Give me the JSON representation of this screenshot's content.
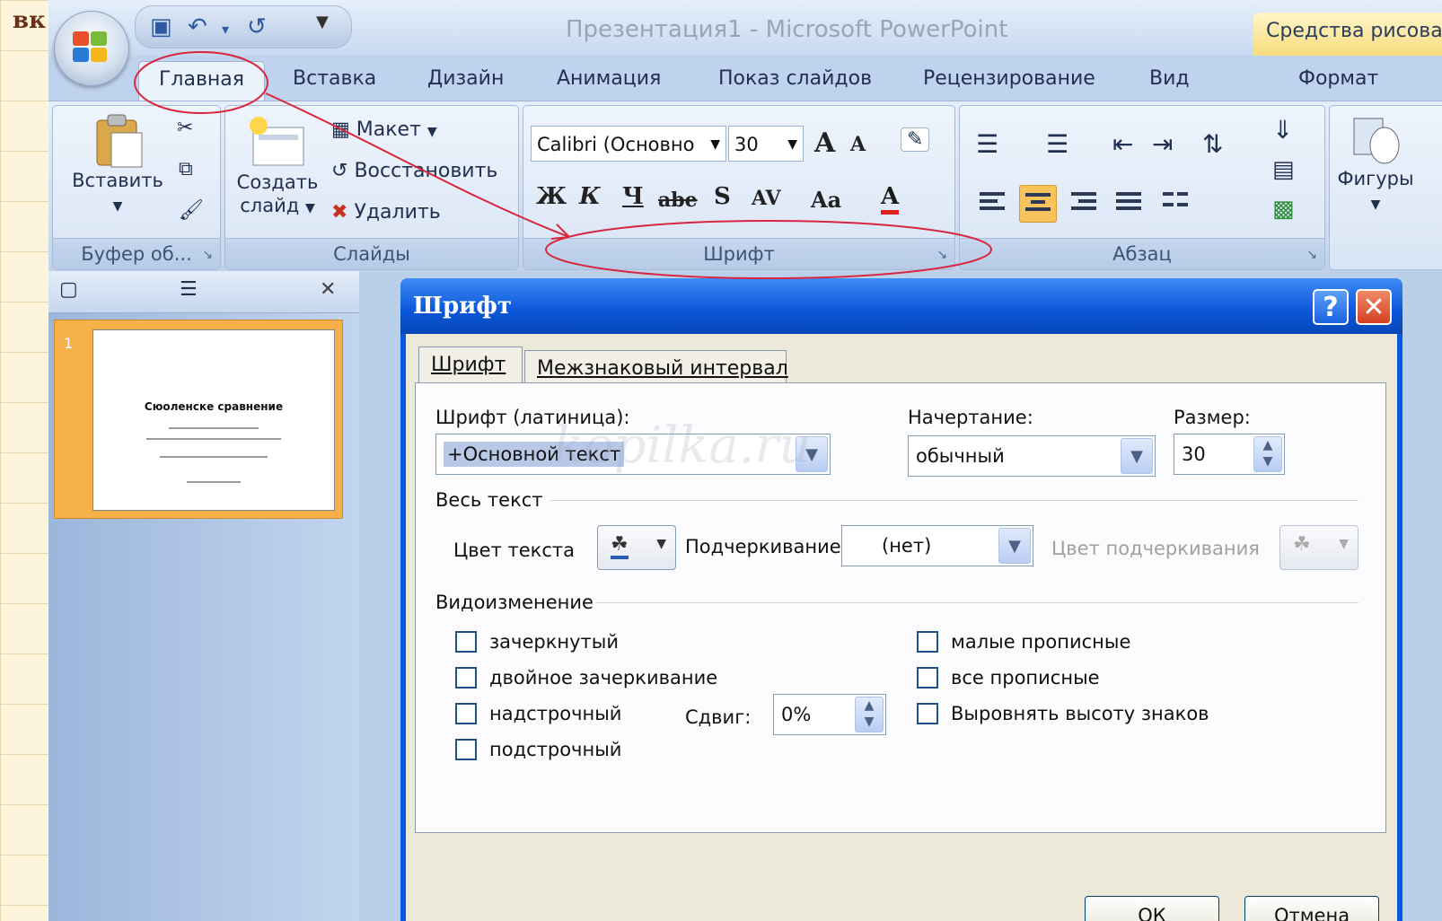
{
  "outer_label": "вк",
  "window": {
    "title": "Презентация1 - Microsoft PowerPoint",
    "context_tab_title": "Средства рисова"
  },
  "ribbon_tabs": [
    "Главная",
    "Вставка",
    "Дизайн",
    "Анимация",
    "Показ слайдов",
    "Рецензирование",
    "Вид",
    "Формат"
  ],
  "clipboard": {
    "paste": "Вставить",
    "group_label": "Буфер об..."
  },
  "slides_group": {
    "new_slide_line1": "Создать",
    "new_slide_line2": "слайд",
    "layout": "Макет",
    "reset": "Восстановить",
    "delete": "Удалить",
    "group_label": "Слайды"
  },
  "font_group": {
    "font_name": "Calibri (Основно",
    "font_size": "30",
    "bold": "Ж",
    "italic": "К",
    "underline": "Ч",
    "strike": "abe",
    "shadow": "S",
    "spacing": "AV",
    "case": "Aa",
    "color_letter": "A",
    "grow": "A",
    "shrink": "A",
    "group_label": "Шрифт"
  },
  "paragraph_group": {
    "group_label": "Абзац"
  },
  "drawing_group": {
    "shapes": "Фигуры"
  },
  "slides_pane": {
    "slide_number": "1",
    "thumb_title": "Сюоленске сравнение"
  },
  "dialog": {
    "title": "Шрифт",
    "tabs": [
      "Шрифт",
      "Межзнаковый интервал"
    ],
    "font_latin_label": "Шрифт (латиница):",
    "font_latin_value": "+Основной текст",
    "style_label": "Начертание:",
    "style_value": "обычный",
    "size_label": "Размер:",
    "size_value": "30",
    "all_text_section": "Весь текст",
    "text_color_label": "Цвет текста",
    "underline_label": "Подчеркивание",
    "underline_value": "(нет)",
    "underline_color_label": "Цвет подчеркивания",
    "effects_section": "Видоизменение",
    "effects_left": [
      "зачеркнутый",
      "двойное зачеркивание",
      "надстрочный",
      "подстрочный"
    ],
    "effects_right": [
      "малые прописные",
      "все прописные",
      "Выровнять высоту знаков"
    ],
    "offset_label": "Сдвиг:",
    "offset_value": "0%",
    "ok": "ОК",
    "cancel": "Отмена"
  },
  "watermark": "kopilka.ru"
}
